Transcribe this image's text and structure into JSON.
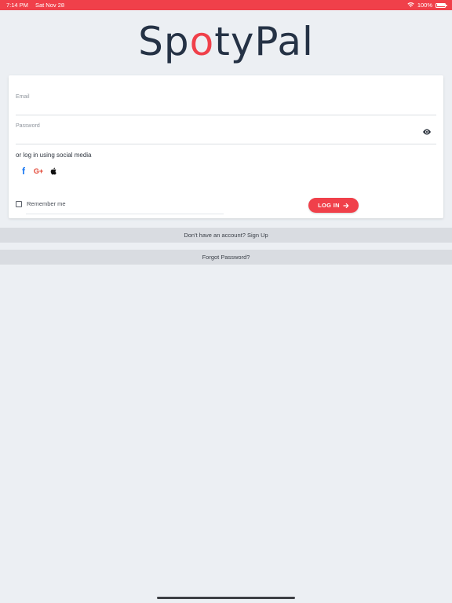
{
  "status_bar": {
    "time": "7:14 PM",
    "date": "Sat Nov 28",
    "battery": "100%",
    "battery_level": 1.0,
    "wifi_icon": "wifi-icon",
    "battery_icon": "battery-icon"
  },
  "logo": {
    "part1": "Sp",
    "accent": "o",
    "part2": "tyPal"
  },
  "login_form": {
    "email_label": "Email",
    "email_value": "",
    "password_label": "Password",
    "password_value": "",
    "password_toggle_icon": "eye-icon",
    "social_prompt": "or log in using social media",
    "social_icons": [
      "facebook-icon",
      "google-plus-icon",
      "apple-icon"
    ],
    "facebook_glyph": "f",
    "google_glyph": "G+",
    "remember_label": "Remember me",
    "remember_checked": false,
    "login_label": "LOG IN",
    "login_icon": "arrow-right-icon"
  },
  "links": {
    "signup": "Don't have an account? Sign Up",
    "forgot": "Forgot Password?"
  },
  "colors": {
    "accent": "#f0404a",
    "logo": "#253245",
    "background": "#eceff3",
    "bar": "#d9dce1",
    "facebook": "#1877f2",
    "google": "#e2412f"
  }
}
